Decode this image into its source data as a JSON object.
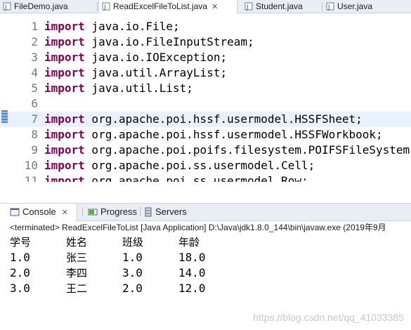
{
  "editor_tabs": [
    {
      "label": "FileDemo.java",
      "active": false,
      "closable": false
    },
    {
      "label": "ReadExcelFileToList.java",
      "active": true,
      "closable": true
    },
    {
      "label": "Student.java",
      "active": false,
      "closable": false
    },
    {
      "label": "User.java",
      "active": false,
      "closable": false
    }
  ],
  "code_lines": [
    {
      "num": "1",
      "kw": "import",
      "rest": " java.io.File;"
    },
    {
      "num": "2",
      "kw": "import",
      "rest": " java.io.FileInputStream;"
    },
    {
      "num": "3",
      "kw": "import",
      "rest": " java.io.IOException;"
    },
    {
      "num": "4",
      "kw": "import",
      "rest": " java.util.ArrayList;"
    },
    {
      "num": "5",
      "kw": "import",
      "rest": " java.util.List;"
    },
    {
      "num": "6",
      "kw": "",
      "rest": ""
    },
    {
      "num": "7",
      "kw": "import",
      "rest": " org.apache.poi.hssf.usermodel.HSSFSheet;"
    },
    {
      "num": "8",
      "kw": "import",
      "rest": " org.apache.poi.hssf.usermodel.HSSFWorkbook;"
    },
    {
      "num": "9",
      "kw": "import",
      "rest": " org.apache.poi.poifs.filesystem.POIFSFileSystem;"
    },
    {
      "num": "10",
      "kw": "import",
      "rest": " org.apache.poi.ss.usermodel.Cell;"
    },
    {
      "num": "11",
      "kw": "import",
      "rest": " org.apache.poi.ss.usermodel.Row;"
    }
  ],
  "view_tabs": [
    {
      "label": "Console",
      "active": true,
      "closable": true,
      "icon": "console-icon"
    },
    {
      "label": "Progress",
      "active": false,
      "closable": false,
      "icon": "progress-icon"
    },
    {
      "label": "Servers",
      "active": false,
      "closable": false,
      "icon": "servers-icon"
    }
  ],
  "console": {
    "status": "<terminated> ReadExcelFileToList [Java Application] D:\\Java\\jdk1.8.0_144\\bin\\javaw.exe (2019年9月",
    "header": [
      "学号",
      "姓名",
      "班级",
      "年龄"
    ],
    "rows": [
      [
        "1.0",
        "张三",
        "1.0",
        "18.0"
      ],
      [
        "2.0",
        "李四",
        "3.0",
        "14.0"
      ],
      [
        "3.0",
        "王二",
        "2.0",
        "12.0"
      ]
    ],
    "watermark": "https://blog.csdn.net/qq_41033385"
  },
  "colors": {
    "keyword": "#7f0055",
    "line_number": "#787878",
    "current_line": "#e8f2fe"
  }
}
